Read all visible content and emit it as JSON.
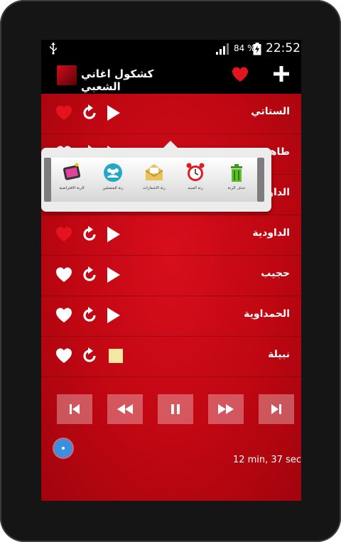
{
  "status_bar": {
    "battery_percent": "84 %",
    "time": "22:52"
  },
  "app_bar": {
    "title": "كشكول اغاني الشعبي"
  },
  "songs": [
    {
      "name": "الستاتي",
      "favorite": true,
      "state": "play"
    },
    {
      "name": "طاهر",
      "favorite": false,
      "state": "play"
    },
    {
      "name": "الداو",
      "favorite": false,
      "state": "play"
    },
    {
      "name": "الداودية",
      "favorite": true,
      "state": "play"
    },
    {
      "name": "حجيب",
      "favorite": false,
      "state": "play"
    },
    {
      "name": "الحمداوية",
      "favorite": false,
      "state": "play"
    },
    {
      "name": "نبيلة",
      "favorite": false,
      "state": "stop"
    }
  ],
  "popup_menu": {
    "items": [
      {
        "label": "حذف الرنة",
        "icon": "trash-icon"
      },
      {
        "label": "رنة المنبه",
        "icon": "alarm-clock-icon"
      },
      {
        "label": "رنة الاشعارات",
        "icon": "notification-envelope-icon"
      },
      {
        "label": "رنة المتصلين",
        "icon": "contacts-icon"
      },
      {
        "label": "الرنة الافتراضية",
        "icon": "phone-ringtone-icon"
      }
    ]
  },
  "player": {
    "duration_text": "12 min, 37 sec",
    "progress": 0
  },
  "colors": {
    "accent_red": "#c50912",
    "favorite_heart": "#e4141e",
    "seek_knob": "#3b8fe0",
    "stop_square": "#f6e7a3"
  }
}
